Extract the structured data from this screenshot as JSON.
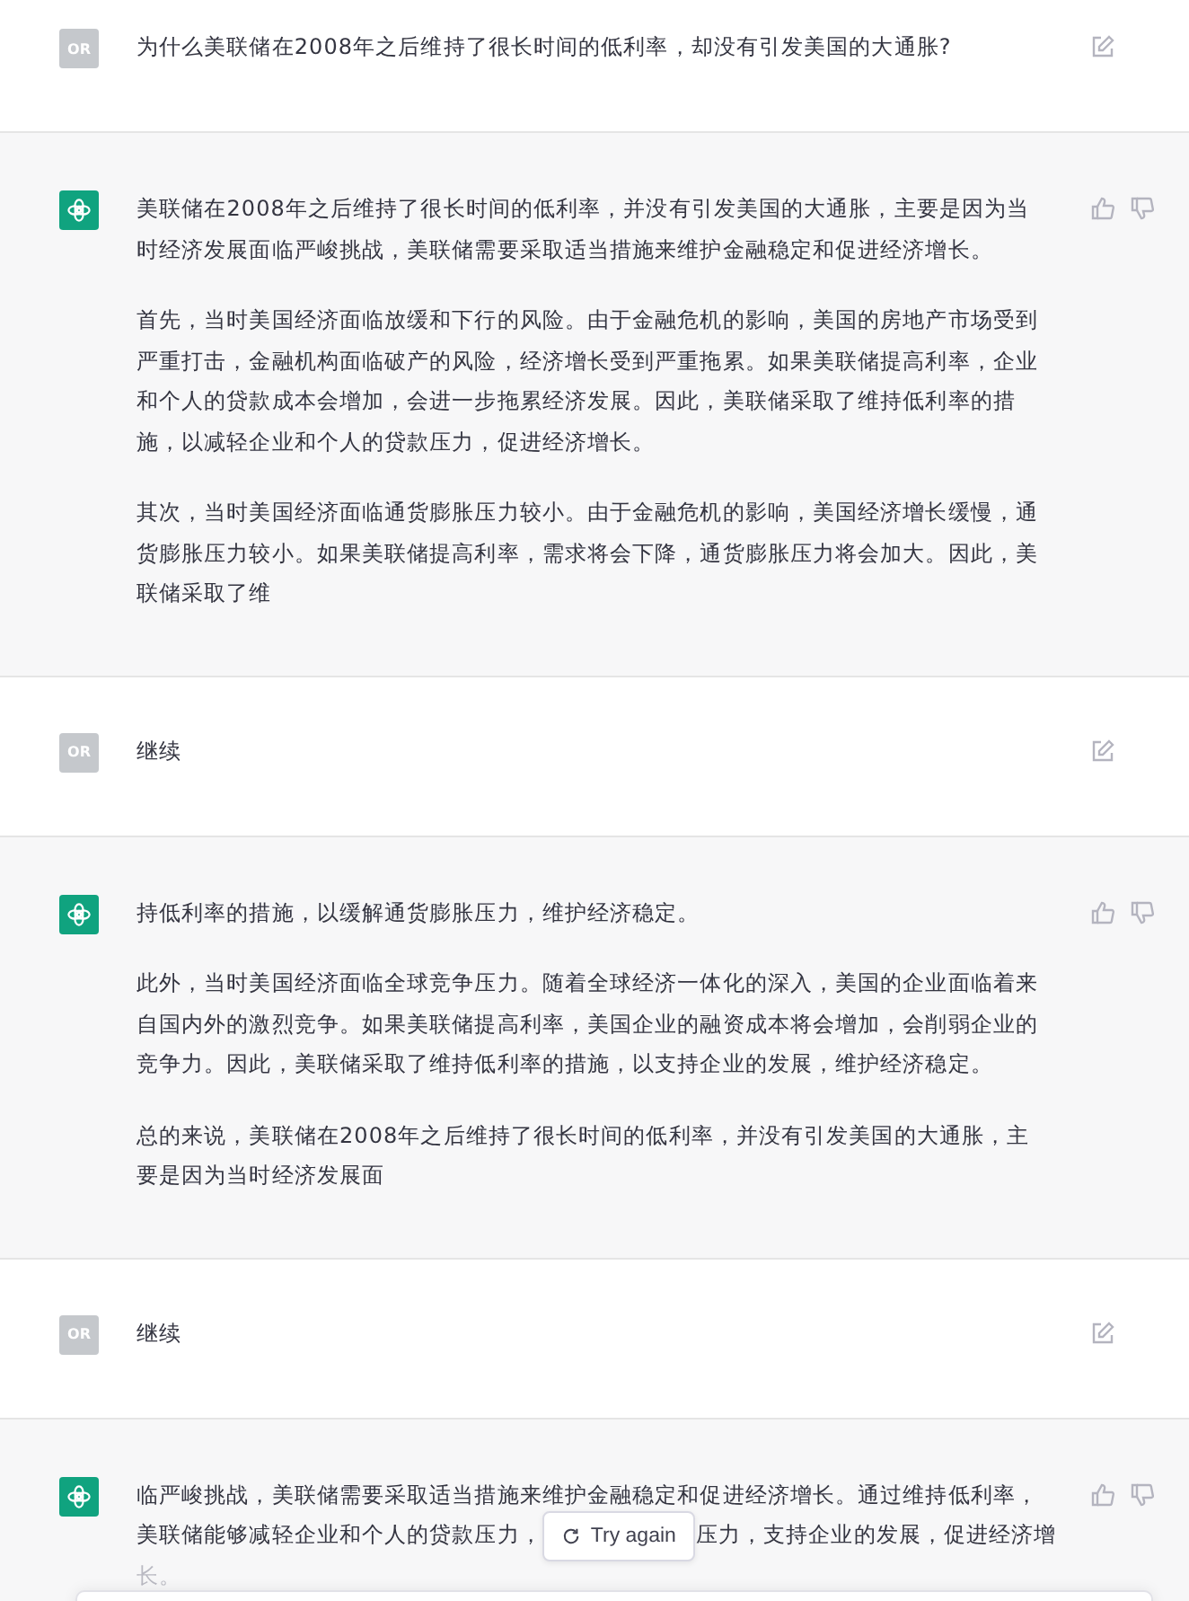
{
  "messages": [
    {
      "kind": "user",
      "avatar": "OR",
      "paragraphs": [
        "为什么美联储在2008年之后维持了很长时间的低利率，却没有引发美国的大通胀?"
      ]
    },
    {
      "kind": "assistant",
      "paragraphs": [
        "美联储在2008年之后维持了很长时间的低利率，并没有引发美国的大通胀，主要是因为当时经济发展面临严峻挑战，美联储需要采取适当措施来维护金融稳定和促进经济增长。",
        "首先，当时美国经济面临放缓和下行的风险。由于金融危机的影响，美国的房地产市场受到严重打击，金融机构面临破产的风险，经济增长受到严重拖累。如果美联储提高利率，企业和个人的贷款成本会增加，会进一步拖累经济发展。因此，美联储采取了维持低利率的措施，以减轻企业和个人的贷款压力，促进经济增长。",
        "其次，当时美国经济面临通货膨胀压力较小。由于金融危机的影响，美国经济增长缓慢，通货膨胀压力较小。如果美联储提高利率，需求将会下降，通货膨胀压力将会加大。因此，美联储采取了维"
      ]
    },
    {
      "kind": "user",
      "avatar": "OR",
      "paragraphs": [
        "继续"
      ]
    },
    {
      "kind": "assistant",
      "paragraphs": [
        "持低利率的措施，以缓解通货膨胀压力，维护经济稳定。",
        "此外，当时美国经济面临全球竞争压力。随着全球经济一体化的深入，美国的企业面临着来自国内外的激烈竞争。如果美联储提高利率，美国企业的融资成本将会增加，会削弱企业的竞争力。因此，美联储采取了维持低利率的措施，以支持企业的发展，维护经济稳定。",
        "总的来说，美联储在2008年之后维持了很长时间的低利率，并没有引发美国的大通胀，主要是因为当时经济发展面"
      ]
    },
    {
      "kind": "user",
      "avatar": "OR",
      "paragraphs": [
        "继续"
      ]
    },
    {
      "kind": "assistant",
      "paragraphs": [
        "临严峻挑战，美联储需要采取适当措施来维护金融稳定和促进经济增长。通过维持低利率，"
      ],
      "covered_line": {
        "before": "美联储能够减轻企业和个人的贷款压力，",
        "after": "压力，支持企业的发展，促进经济增"
      },
      "faded_tail": "长。",
      "try_again": {
        "label": "Try again"
      }
    }
  ]
}
